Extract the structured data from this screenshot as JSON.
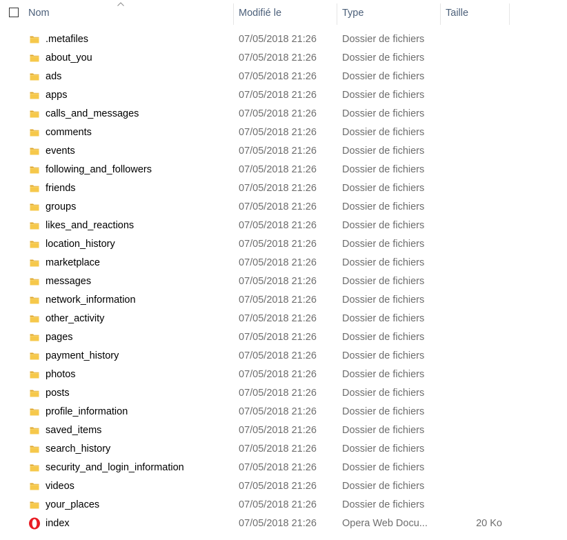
{
  "header": {
    "name_label": "Nom",
    "date_label": "Modifié le",
    "type_label": "Type",
    "size_label": "Taille",
    "sort_column": "Nom",
    "sort_direction": "ascending"
  },
  "colors": {
    "folder": "#f6c84b",
    "folder_dark": "#e0a82e",
    "opera_red": "#e81c24",
    "header_text": "#4c607a",
    "secondary_text": "#6d6d6d"
  },
  "files": [
    {
      "name": ".metafiles",
      "modified": "07/05/2018 21:26",
      "type": "Dossier de fichiers",
      "size": "",
      "icon": "folder-icon"
    },
    {
      "name": "about_you",
      "modified": "07/05/2018 21:26",
      "type": "Dossier de fichiers",
      "size": "",
      "icon": "folder-icon"
    },
    {
      "name": "ads",
      "modified": "07/05/2018 21:26",
      "type": "Dossier de fichiers",
      "size": "",
      "icon": "folder-icon"
    },
    {
      "name": "apps",
      "modified": "07/05/2018 21:26",
      "type": "Dossier de fichiers",
      "size": "",
      "icon": "folder-icon"
    },
    {
      "name": "calls_and_messages",
      "modified": "07/05/2018 21:26",
      "type": "Dossier de fichiers",
      "size": "",
      "icon": "folder-icon"
    },
    {
      "name": "comments",
      "modified": "07/05/2018 21:26",
      "type": "Dossier de fichiers",
      "size": "",
      "icon": "folder-icon"
    },
    {
      "name": "events",
      "modified": "07/05/2018 21:26",
      "type": "Dossier de fichiers",
      "size": "",
      "icon": "folder-icon"
    },
    {
      "name": "following_and_followers",
      "modified": "07/05/2018 21:26",
      "type": "Dossier de fichiers",
      "size": "",
      "icon": "folder-icon"
    },
    {
      "name": "friends",
      "modified": "07/05/2018 21:26",
      "type": "Dossier de fichiers",
      "size": "",
      "icon": "folder-icon"
    },
    {
      "name": "groups",
      "modified": "07/05/2018 21:26",
      "type": "Dossier de fichiers",
      "size": "",
      "icon": "folder-icon"
    },
    {
      "name": "likes_and_reactions",
      "modified": "07/05/2018 21:26",
      "type": "Dossier de fichiers",
      "size": "",
      "icon": "folder-icon"
    },
    {
      "name": "location_history",
      "modified": "07/05/2018 21:26",
      "type": "Dossier de fichiers",
      "size": "",
      "icon": "folder-icon"
    },
    {
      "name": "marketplace",
      "modified": "07/05/2018 21:26",
      "type": "Dossier de fichiers",
      "size": "",
      "icon": "folder-icon"
    },
    {
      "name": "messages",
      "modified": "07/05/2018 21:26",
      "type": "Dossier de fichiers",
      "size": "",
      "icon": "folder-icon"
    },
    {
      "name": "network_information",
      "modified": "07/05/2018 21:26",
      "type": "Dossier de fichiers",
      "size": "",
      "icon": "folder-icon"
    },
    {
      "name": "other_activity",
      "modified": "07/05/2018 21:26",
      "type": "Dossier de fichiers",
      "size": "",
      "icon": "folder-icon"
    },
    {
      "name": "pages",
      "modified": "07/05/2018 21:26",
      "type": "Dossier de fichiers",
      "size": "",
      "icon": "folder-icon"
    },
    {
      "name": "payment_history",
      "modified": "07/05/2018 21:26",
      "type": "Dossier de fichiers",
      "size": "",
      "icon": "folder-icon"
    },
    {
      "name": "photos",
      "modified": "07/05/2018 21:26",
      "type": "Dossier de fichiers",
      "size": "",
      "icon": "folder-icon"
    },
    {
      "name": "posts",
      "modified": "07/05/2018 21:26",
      "type": "Dossier de fichiers",
      "size": "",
      "icon": "folder-icon"
    },
    {
      "name": "profile_information",
      "modified": "07/05/2018 21:26",
      "type": "Dossier de fichiers",
      "size": "",
      "icon": "folder-icon"
    },
    {
      "name": "saved_items",
      "modified": "07/05/2018 21:26",
      "type": "Dossier de fichiers",
      "size": "",
      "icon": "folder-icon"
    },
    {
      "name": "search_history",
      "modified": "07/05/2018 21:26",
      "type": "Dossier de fichiers",
      "size": "",
      "icon": "folder-icon"
    },
    {
      "name": "security_and_login_information",
      "modified": "07/05/2018 21:26",
      "type": "Dossier de fichiers",
      "size": "",
      "icon": "folder-icon"
    },
    {
      "name": "videos",
      "modified": "07/05/2018 21:26",
      "type": "Dossier de fichiers",
      "size": "",
      "icon": "folder-icon"
    },
    {
      "name": "your_places",
      "modified": "07/05/2018 21:26",
      "type": "Dossier de fichiers",
      "size": "",
      "icon": "folder-icon"
    },
    {
      "name": "index",
      "modified": "07/05/2018 21:26",
      "type": "Opera Web Docu...",
      "size": "20 Ko",
      "icon": "opera-icon"
    }
  ]
}
